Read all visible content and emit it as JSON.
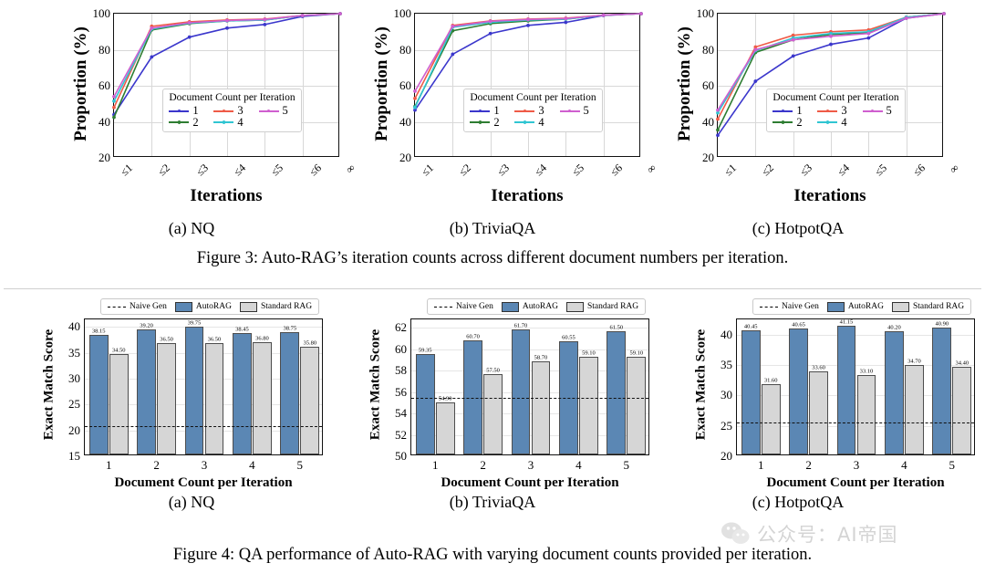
{
  "figure3": {
    "caption": "Figure 3: Auto-RAG’s iteration counts across different document numbers per iteration.",
    "subcaptions": [
      "(a) NQ",
      "(b) TriviaQA",
      "(c) HotpotQA"
    ],
    "legend_title": "Document Count per Iteration",
    "legend_labels": [
      "1",
      "2",
      "3",
      "4",
      "5"
    ],
    "series_colors": [
      "#3b37cc",
      "#2e7d32",
      "#ef5b47",
      "#30c5d2",
      "#cf5fcf"
    ],
    "ylabel": "Proportion (%)",
    "xlabel": "Iterations",
    "yticks": [
      "20",
      "40",
      "60",
      "80",
      "100"
    ],
    "xticks": [
      "≤1",
      "≤2",
      "≤3",
      "≤4",
      "≤5",
      "≤6",
      "∞"
    ]
  },
  "figure4": {
    "caption": "Figure 4: QA performance of Auto-RAG with varying document counts provided per iteration.",
    "subcaptions": [
      "(a) NQ",
      "(b) TriviaQA",
      "(c) HotpotQA"
    ],
    "legend_labels": [
      "Naive Gen",
      "AutoRAG",
      "Standard RAG"
    ],
    "ylabel": "Exact Match Score",
    "xlabel": "Document Count per Iteration",
    "colors": {
      "autorag": "#5b87b4",
      "standard": "#d6d6d6",
      "naive": "#111111"
    }
  },
  "watermark": {
    "text": "公众号：AI帝国",
    "icon": "wechat-icon"
  },
  "chart_data": [
    {
      "type": "line",
      "title": "(a) NQ",
      "xlabel": "Iterations",
      "ylabel": "Proportion (%)",
      "x": [
        "≤1",
        "≤2",
        "≤3",
        "≤4",
        "≤5",
        "≤6",
        "∞"
      ],
      "ylim": [
        20,
        100
      ],
      "yticks": [
        20,
        40,
        60,
        80,
        100
      ],
      "grid": true,
      "legend_position": "lower-center",
      "legend_title": "Document Count per Iteration",
      "series": [
        {
          "name": "1",
          "color": "#3b37cc",
          "values": [
            44.0,
            76.0,
            87.0,
            92.0,
            94.0,
            98.5,
            100
          ]
        },
        {
          "name": "2",
          "color": "#2e7d32",
          "values": [
            42.5,
            91.0,
            94.5,
            96.0,
            96.5,
            99.0,
            100
          ]
        },
        {
          "name": "3",
          "color": "#ef5b47",
          "values": [
            48.0,
            93.0,
            95.5,
            96.5,
            97.0,
            99.0,
            100
          ]
        },
        {
          "name": "4",
          "color": "#30c5d2",
          "values": [
            51.5,
            91.5,
            94.8,
            96.0,
            96.5,
            99.0,
            100
          ]
        },
        {
          "name": "5",
          "color": "#cf5fcf",
          "values": [
            54.0,
            92.0,
            95.0,
            96.2,
            96.8,
            99.0,
            100
          ]
        }
      ]
    },
    {
      "type": "line",
      "title": "(b) TriviaQA",
      "xlabel": "Iterations",
      "ylabel": "Proportion (%)",
      "x": [
        "≤1",
        "≤2",
        "≤3",
        "≤4",
        "≤5",
        "≤6",
        "∞"
      ],
      "ylim": [
        20,
        100
      ],
      "yticks": [
        20,
        40,
        60,
        80,
        100
      ],
      "grid": true,
      "legend_position": "lower-center",
      "legend_title": "Document Count per Iteration",
      "series": [
        {
          "name": "1",
          "color": "#3b37cc",
          "values": [
            46.5,
            77.5,
            89.0,
            93.5,
            95.2,
            99.0,
            100
          ]
        },
        {
          "name": "2",
          "color": "#2e7d32",
          "values": [
            48.5,
            90.5,
            94.5,
            96.0,
            97.0,
            99.2,
            100
          ]
        },
        {
          "name": "3",
          "color": "#ef5b47",
          "values": [
            53.0,
            93.5,
            96.0,
            97.0,
            97.5,
            99.2,
            100
          ]
        },
        {
          "name": "4",
          "color": "#30c5d2",
          "values": [
            48.0,
            92.5,
            95.2,
            96.5,
            97.0,
            99.2,
            100
          ]
        },
        {
          "name": "5",
          "color": "#cf5fcf",
          "values": [
            57.0,
            93.0,
            95.8,
            96.8,
            97.3,
            99.2,
            100
          ]
        }
      ]
    },
    {
      "type": "line",
      "title": "(c) HotpotQA",
      "xlabel": "Iterations",
      "ylabel": "Proportion (%)",
      "x": [
        "≤1",
        "≤2",
        "≤3",
        "≤4",
        "≤5",
        "≤6",
        "∞"
      ],
      "ylim": [
        20,
        100
      ],
      "yticks": [
        20,
        40,
        60,
        80,
        100
      ],
      "grid": true,
      "legend_position": "lower-center",
      "legend_title": "Document Count per Iteration",
      "series": [
        {
          "name": "1",
          "color": "#3b37cc",
          "values": [
            32.5,
            62.5,
            76.5,
            83.0,
            86.5,
            97.5,
            100
          ]
        },
        {
          "name": "2",
          "color": "#2e7d32",
          "values": [
            35.5,
            78.5,
            85.5,
            88.5,
            89.5,
            98.0,
            100
          ]
        },
        {
          "name": "3",
          "color": "#ef5b47",
          "values": [
            41.5,
            81.5,
            88.0,
            90.0,
            91.0,
            98.0,
            100
          ]
        },
        {
          "name": "4",
          "color": "#30c5d2",
          "values": [
            45.0,
            79.5,
            86.5,
            89.0,
            90.0,
            98.0,
            100
          ]
        },
        {
          "name": "5",
          "color": "#cf5fcf",
          "values": [
            46.5,
            80.0,
            85.5,
            87.5,
            89.0,
            97.5,
            100
          ]
        }
      ]
    },
    {
      "type": "bar",
      "title": "(a) NQ",
      "xlabel": "Document Count per Iteration",
      "ylabel": "Exact Match Score",
      "categories": [
        "1",
        "2",
        "3",
        "4",
        "5"
      ],
      "ylim": [
        15,
        41.5
      ],
      "yticks": [
        15,
        20,
        25,
        30,
        35,
        40
      ],
      "naive_gen": 20.8,
      "series": [
        {
          "name": "AutoRAG",
          "color": "#5b87b4",
          "values": [
            38.15,
            39.2,
            39.75,
            38.45,
            38.75
          ],
          "labels": [
            "38.15",
            "39.20",
            "39.75",
            "38.45",
            "38.75"
          ]
        },
        {
          "name": "Standard RAG",
          "color": "#d6d6d6",
          "values": [
            34.5,
            36.5,
            36.5,
            36.8,
            35.8
          ],
          "labels": [
            "34.50",
            "36.50",
            "36.50",
            "36.80",
            "35.80"
          ]
        }
      ]
    },
    {
      "type": "bar",
      "title": "(b) TriviaQA",
      "xlabel": "Document Count per Iteration",
      "ylabel": "Exact Match Score",
      "categories": [
        "1",
        "2",
        "3",
        "4",
        "5"
      ],
      "ylim": [
        50,
        62.8
      ],
      "yticks": [
        50,
        52,
        54,
        56,
        58,
        60,
        62
      ],
      "naive_gen": 55.45,
      "series": [
        {
          "name": "AutoRAG",
          "color": "#5b87b4",
          "values": [
            59.35,
            60.7,
            61.7,
            60.55,
            61.5
          ],
          "labels": [
            "59.35",
            "60.70",
            "61.70",
            "60.55",
            "61.50"
          ]
        },
        {
          "name": "Standard RAG",
          "color": "#d6d6d6",
          "values": [
            54.9,
            57.5,
            58.7,
            59.1,
            59.1
          ],
          "labels": [
            "54.90",
            "57.50",
            "58.70",
            "59.10",
            "59.10"
          ]
        }
      ]
    },
    {
      "type": "bar",
      "title": "(c) HotpotQA",
      "xlabel": "Document Count per Iteration",
      "ylabel": "Exact Match Score",
      "categories": [
        "1",
        "2",
        "3",
        "4",
        "5"
      ],
      "ylim": [
        20,
        42.5
      ],
      "yticks": [
        20,
        25,
        30,
        35,
        40
      ],
      "naive_gen": 25.6,
      "series": [
        {
          "name": "AutoRAG",
          "color": "#5b87b4",
          "values": [
            40.45,
            40.65,
            41.15,
            40.2,
            40.9
          ],
          "labels": [
            "40.45",
            "40.65",
            "41.15",
            "40.20",
            "40.90"
          ]
        },
        {
          "name": "Standard RAG",
          "color": "#d6d6d6",
          "values": [
            31.6,
            33.6,
            33.1,
            34.7,
            34.4
          ],
          "labels": [
            "31.60",
            "33.60",
            "33.10",
            "34.70",
            "34.40"
          ]
        }
      ]
    }
  ]
}
